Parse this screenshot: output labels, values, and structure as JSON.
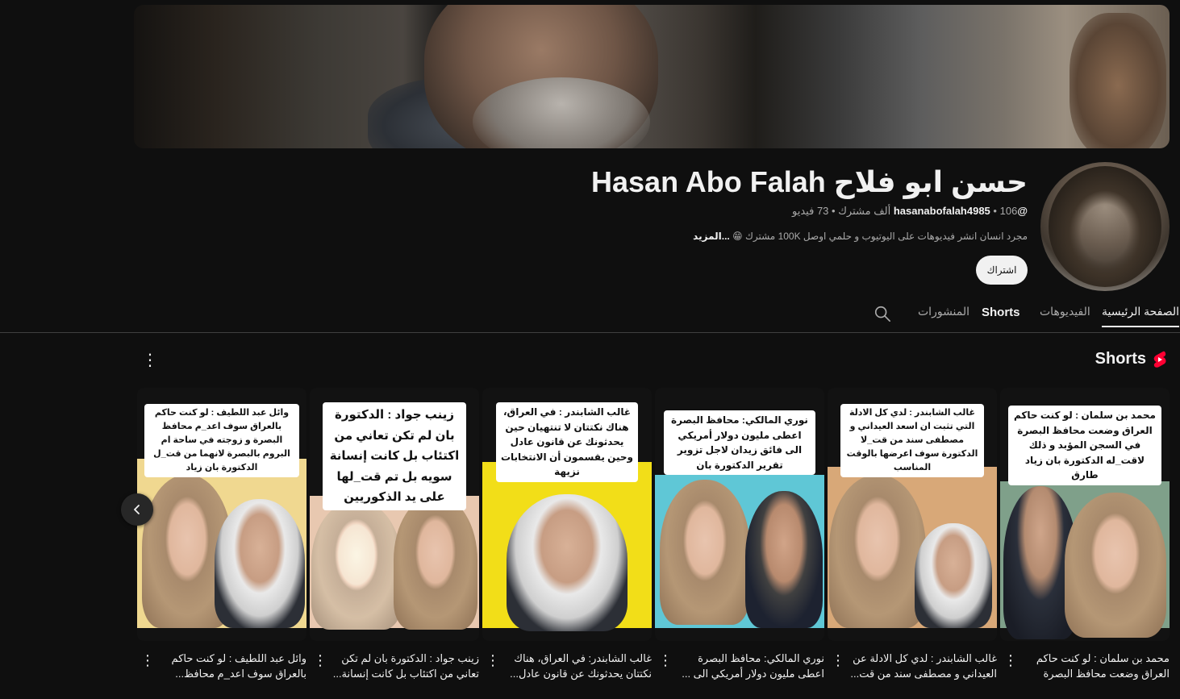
{
  "channel": {
    "name": "حسن ابو فلاح Hasan Abo Falah",
    "handle": "@hasanabofalah4985",
    "subscribers": "106 ألف مشترك",
    "videos": "73 فيديو",
    "separator": "•",
    "description": "مجرد انسان انشر فيديوهات على اليوتيوب و حلمي اوصل 100K مشترك",
    "description_emoji": "😁",
    "more_label": "...المزيد",
    "subscribe_label": "اشتراك"
  },
  "tabs": [
    {
      "label": "الصفحة الرئيسية",
      "active": true
    },
    {
      "label": "الفيديوهات",
      "active": false
    },
    {
      "label": "Shorts",
      "active": false
    },
    {
      "label": "المنشورات",
      "active": false
    }
  ],
  "shorts_section": {
    "title": "Shorts",
    "accent": "#ff0033"
  },
  "shorts": [
    {
      "caption": "محمد بن سلمان : لو كنت حاكم العراق وضعت محافظ البصرة في السجن المؤبد و ذلك لاقت_له الدكتورة بان زياد طارق",
      "title": "محمد بن سلمان : لو كنت حاكم العراق وضعت محافظ البصرة ف..."
    },
    {
      "caption": "غالب الشابندر : لدي كل الادلة التي تثبت ان اسعد العيداني و مصطفى سند من قت_لا الدكتورة سوف اعرضها بالوقت المناسب",
      "title": "غالب الشابندر : لدي كل الادلة عن العيداني و مصطفى سند من قت..."
    },
    {
      "caption": "نوري المالكي: محافظ البصرة اعطى مليون دولار أمريكي الى فائق زيدان لاجل تزوير تقرير الدكتورة بان",
      "title": "نوري المالكي: محافظ البصرة اعطى مليون دولار أمريكي الى ..."
    },
    {
      "caption": "غالب الشابندر : في العراق، هناك نكتتان لا تنتهيان حين يحدثونك عن قانون عادل وحين يقسمون أن الانتخابات نزيهة",
      "title": "غالب الشابندر: في العراق، هناك نكتتان يحدثونك عن قانون عادل..."
    },
    {
      "caption": "زينب جواد : الدكتورة بان لم تكن تعاني من اكتئاب بل كانت إنسانة سويه بل تم قت_لها على يد الذكوريين",
      "title": "زينب جواد : الدكتورة بان لم تكن تعاني من اكتئاب بل كانت إنسانة..."
    },
    {
      "caption": "وائل عبد اللطيف : لو كنت حاكم بالعراق سوف اعد_م محافظ البصرة و زوجته في ساحة ام البروم بالبصرة لانهما من قت_ل الدكتورة بان زياد",
      "title": "وائل عبد اللطيف : لو كنت حاكم بالعراق سوف اعد_م محافظ..."
    }
  ]
}
